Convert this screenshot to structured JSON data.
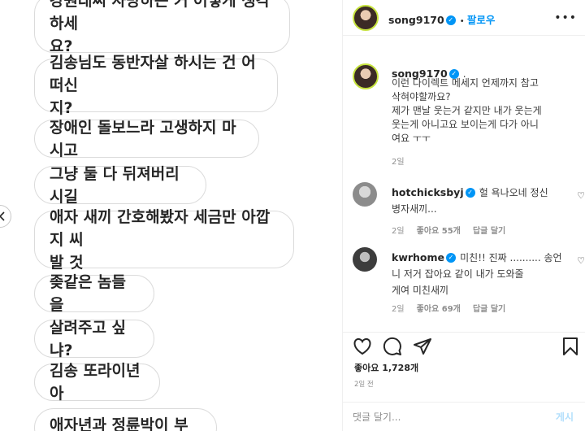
{
  "dm": {
    "messages": [
      "강원래씨 사망하는 거 어떻게 생각하세\n요?",
      "김송님도 동반자살 하시는 건 어떠신\n지?",
      "장애인 돌보느라 고생하지 마시고",
      "그냥 둘 다 뒤져버리시길",
      "애자 새끼 간호해봤자 세금만 아깝지 씨\n발 것",
      "좆같은 놈들을",
      "살려주고 싶냐?",
      "김송 또라이년아",
      "애자년과 정륜박이 부부"
    ]
  },
  "post": {
    "header": {
      "username": "song9170",
      "follow": "팔로우"
    },
    "caption": {
      "username": "song9170",
      "suffix": ".",
      "text": "이런 다이렉트 메세지 언제까지 참고\n삭혀야할까요?\n제가 맨날 웃는거 같지만 내가 웃는게\n웃는게 아니고요 보이는게 다가 아니\n여요 ㅜㅜ",
      "time": "2일"
    },
    "comments": [
      {
        "username": "hotchicksbyj",
        "text": "헐 욕나오네 정신\n병자새끼...",
        "time": "2일",
        "likes": "좋아요 55개",
        "reply": "답글 달기"
      },
      {
        "username": "kwrhome",
        "text": "미친!! 진짜 .......... 송언\n니 저거 잡아요 같이 내가 도와줄\n게여 미친새끼",
        "time": "2일",
        "likes": "좋아요 69개",
        "reply": "답글 달기"
      }
    ],
    "likes": "좋아요 1,728개",
    "posted": "2일 전",
    "comment_placeholder": "댓글 달기...",
    "post_button": "게시"
  }
}
